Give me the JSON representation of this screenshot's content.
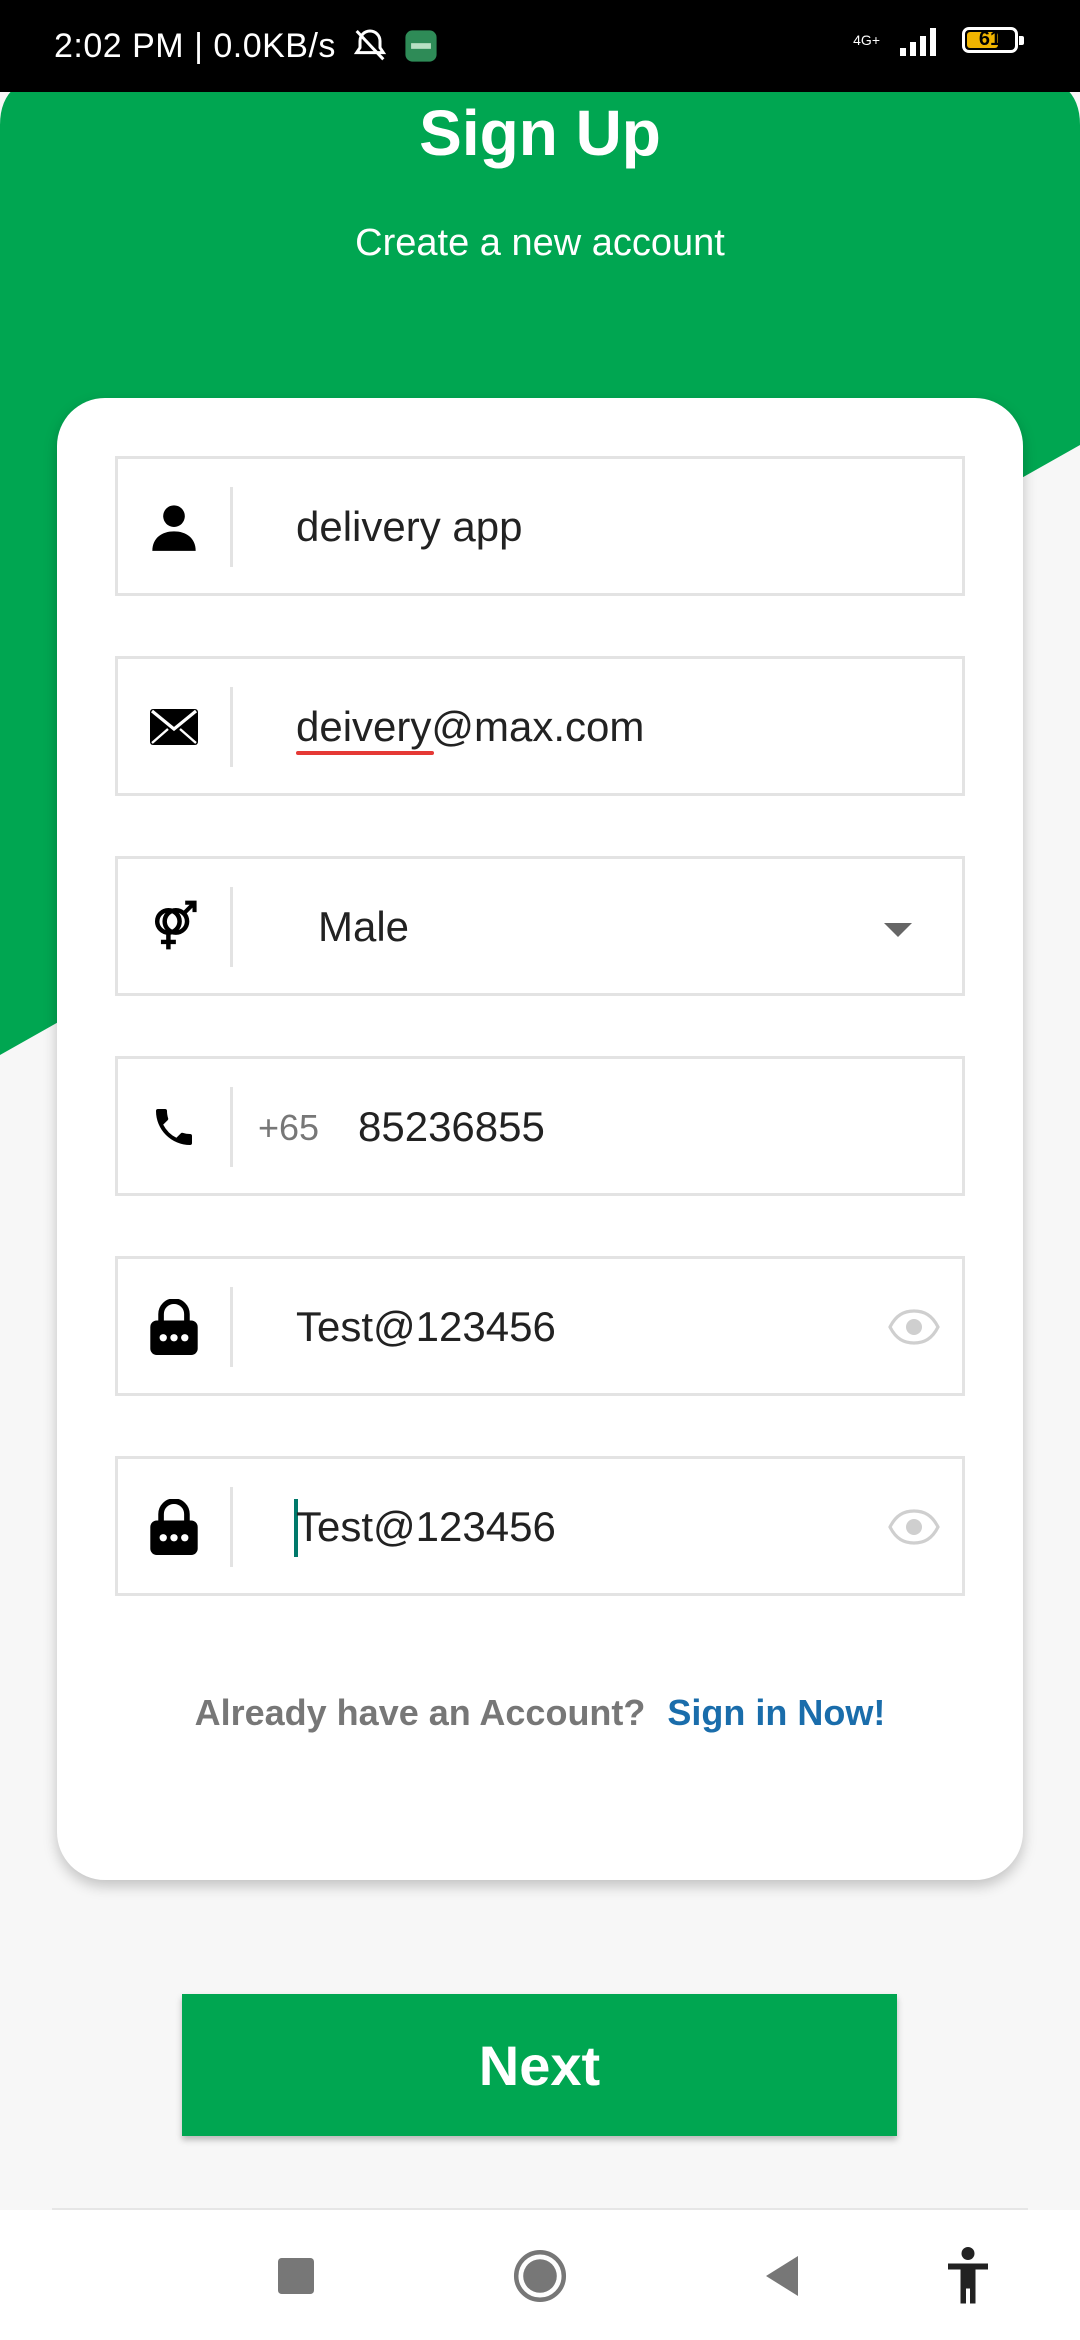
{
  "status_bar": {
    "time_text": "2:02 PM | 0.0KB/s",
    "network": "4G+",
    "battery_level": "61"
  },
  "header": {
    "title": "Sign Up",
    "subtitle": "Create a new account"
  },
  "form": {
    "name_value": "delivery app",
    "email_value": "deivery@max.com",
    "gender_value": "Male",
    "phone_prefix": "+65",
    "phone_value": "85236855",
    "password_value": "Test@123456",
    "confirm_password_value": "Test@123456"
  },
  "footer_text": {
    "already_label": "Already have an Account?",
    "signin_label": "Sign in Now!"
  },
  "next_button": {
    "label": "Next"
  },
  "colors": {
    "primary_green": "#00a651",
    "link_blue": "#1a6dab"
  }
}
